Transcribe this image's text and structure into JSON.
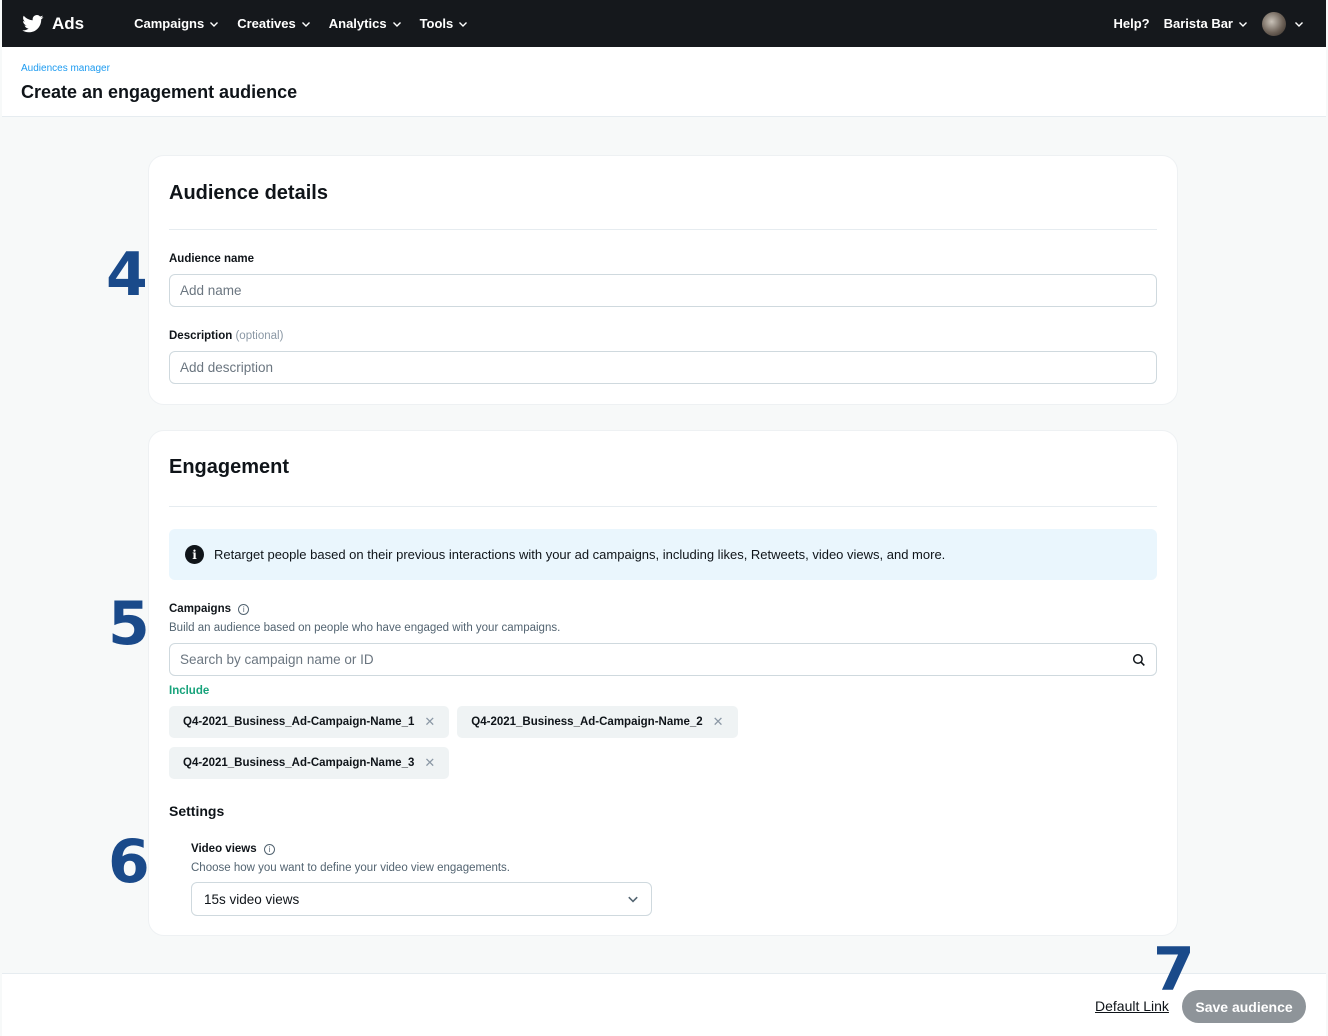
{
  "nav": {
    "brand": "Ads",
    "menu": [
      {
        "label": "Campaigns"
      },
      {
        "label": "Creatives"
      },
      {
        "label": "Analytics"
      },
      {
        "label": "Tools"
      }
    ],
    "help": "Help?",
    "account": "Barista Bar"
  },
  "header": {
    "breadcrumb": "Audiences manager",
    "title": "Create an engagement audience"
  },
  "audience_details": {
    "title": "Audience details",
    "name_label": "Audience name",
    "name_placeholder": "Add name",
    "description_label": "Description",
    "description_optional": "(optional)",
    "description_placeholder": "Add description"
  },
  "engagement": {
    "title": "Engagement",
    "info_text": "Retarget people based on their previous interactions with your ad campaigns, including likes, Retweets, video views, and more.",
    "campaigns_label": "Campaigns",
    "campaigns_help": "Build an audience based on people who have engaged with your campaigns.",
    "search_placeholder": "Search by campaign name or ID",
    "include_label": "Include",
    "chips": [
      "Q4-2021_Business_Ad-Campaign-Name_1",
      "Q4-2021_Business_Ad-Campaign-Name_2",
      "Q4-2021_Business_Ad-Campaign-Name_3"
    ],
    "settings_label": "Settings",
    "video_label": "Video views",
    "video_help": "Choose how you want to define your video view engagements.",
    "video_value": "15s video views"
  },
  "steps": [
    "4",
    "5",
    "6",
    "7"
  ],
  "footer": {
    "default_link": "Default Link",
    "save_label": "Save audience"
  },
  "colors": {
    "nav_bg": "#15181c",
    "accent": "#1d9bf0",
    "step_number": "#1a4a8a",
    "include_green": "#17a37b",
    "save_disabled": "#8e9499"
  }
}
